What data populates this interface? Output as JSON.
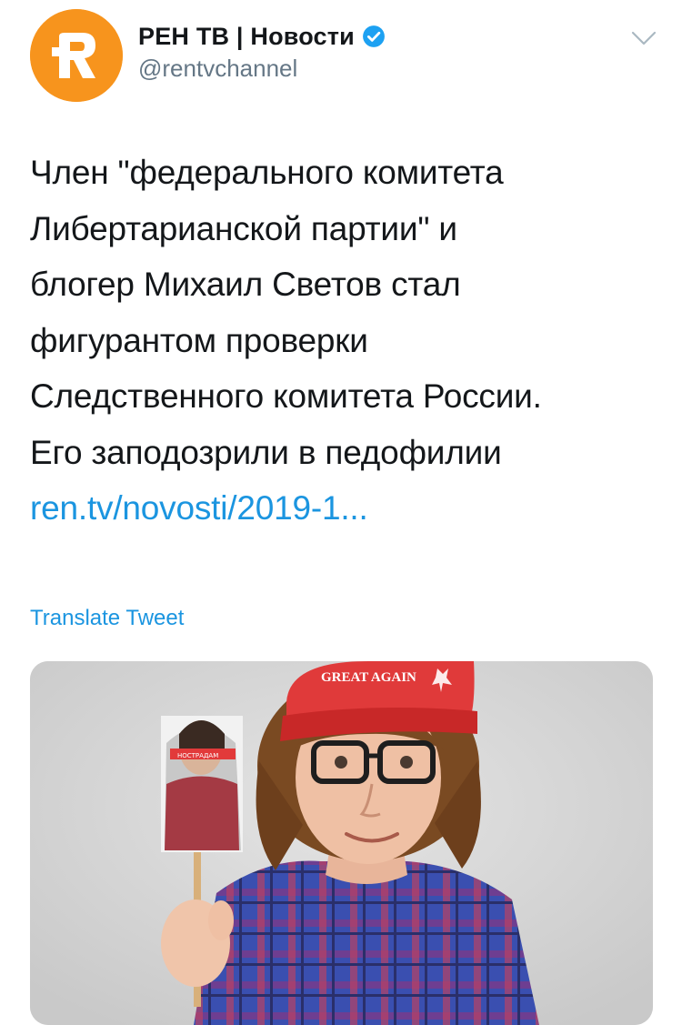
{
  "author": {
    "display_name": "РЕН ТВ | Новости",
    "handle": "@rentvchannel",
    "verified": true,
    "avatar_icon": "ren-tv-logo-icon",
    "avatar_color": "#f7941d"
  },
  "tweet": {
    "text_lines": [
      "Член \"федерального комитета",
      "Либертарианской партии\" и",
      "блогер Михаил Светов стал",
      "фигурантом проверки",
      "Следственного комитета России.",
      "Его заподозрили в педофилии"
    ],
    "link_text": "ren.tv/novosti/2019-1...",
    "translate_label": "Translate Tweet"
  },
  "media": {
    "cap_text": "GREAT AGAIN",
    "sign_text": "НОСТРАДАМ"
  },
  "colors": {
    "link": "#1b95e0",
    "secondary_text": "#657786",
    "verified": "#1da1f2"
  }
}
